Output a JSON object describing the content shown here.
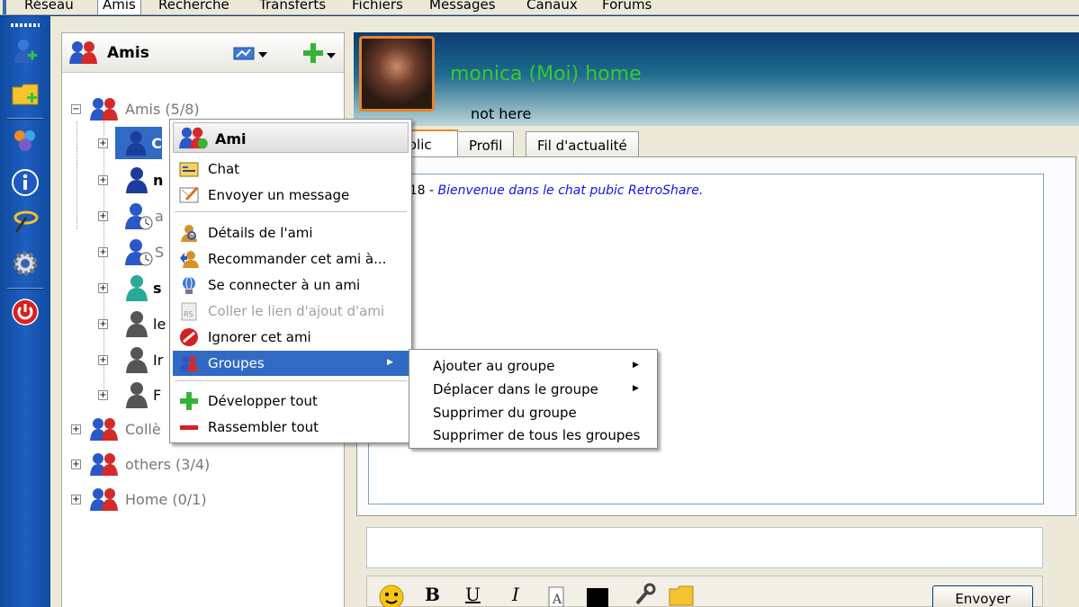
{
  "menubar": {
    "items": [
      {
        "label": "Réseau",
        "active": false
      },
      {
        "label": "Amis",
        "active": true
      },
      {
        "label": "Recherche",
        "active": false
      },
      {
        "label": "Transferts",
        "active": false
      },
      {
        "label": "Fichiers",
        "active": false
      },
      {
        "label": "Messages",
        "active": false
      },
      {
        "label": "Canaux",
        "active": false
      },
      {
        "label": "Forums",
        "active": false
      }
    ]
  },
  "left_toolbar": {
    "icons": [
      "add-friend-icon",
      "add-share-icon",
      "network-icon",
      "info-icon",
      "channels-icon",
      "settings-icon",
      "power-icon"
    ]
  },
  "friends_panel": {
    "title": "Amis",
    "groups": [
      {
        "label": "Amis (5/8)",
        "expanded": true
      },
      {
        "label": "Collè"
      },
      {
        "label": "others (3/4)"
      },
      {
        "label": "Home (0/1)"
      }
    ],
    "friends": [
      {
        "label": "C",
        "selected": true
      },
      {
        "label": "n"
      },
      {
        "label": "a"
      },
      {
        "label": "S"
      },
      {
        "label": "s"
      },
      {
        "label": "le"
      },
      {
        "label": "Ir"
      },
      {
        "label": "F"
      }
    ]
  },
  "profile": {
    "name": "monica (Moi) home",
    "status": "not here"
  },
  "tabs": [
    {
      "label": "ublic",
      "active": true
    },
    {
      "label": "Profil",
      "active": false
    },
    {
      "label": "Fil d'actualité",
      "active": false
    }
  ],
  "chat": {
    "timestamp": ":18 -",
    "message": "Bienvenue dans le chat pubic RetroShare."
  },
  "format_bar": {
    "bold": "B",
    "underline": "U",
    "italic": "I",
    "send_label": "Envoyer",
    "color": "#000000"
  },
  "context_menu": {
    "header": "Ami",
    "items": [
      {
        "label": "Chat",
        "icon": "chat-icon",
        "disabled": false
      },
      {
        "label": "Envoyer un message",
        "icon": "message-icon",
        "disabled": false
      },
      {
        "label": "Détails de l'ami",
        "icon": "details-icon",
        "disabled": false
      },
      {
        "label": "Recommander cet ami à...",
        "icon": "recommend-icon",
        "disabled": false
      },
      {
        "label": "Se connecter à un ami",
        "icon": "connect-icon",
        "disabled": false
      },
      {
        "label": "Coller le lien d'ajout d'ami",
        "icon": "paste-link-icon",
        "disabled": true
      },
      {
        "label": "Ignorer cet ami",
        "icon": "ignore-icon",
        "disabled": false
      },
      {
        "label": "Groupes",
        "icon": "groups-icon",
        "disabled": false,
        "highlighted": true
      },
      {
        "label": "Développer tout",
        "icon": "expand-all-icon",
        "disabled": false
      },
      {
        "label": "Rassembler tout",
        "icon": "collapse-all-icon",
        "disabled": false
      }
    ]
  },
  "submenu": {
    "items": [
      {
        "label": "Ajouter au groupe",
        "has_submenu": true
      },
      {
        "label": "Déplacer dans le groupe",
        "has_submenu": true
      },
      {
        "label": "Supprimer du groupe",
        "has_submenu": false
      },
      {
        "label": "Supprimer de tous les groupes",
        "has_submenu": false
      }
    ]
  },
  "colors": {
    "accent": "#316ac5",
    "profile_name": "#38c830",
    "chat_message": "#1212f0",
    "tab_highlight": "#e68b2c"
  }
}
